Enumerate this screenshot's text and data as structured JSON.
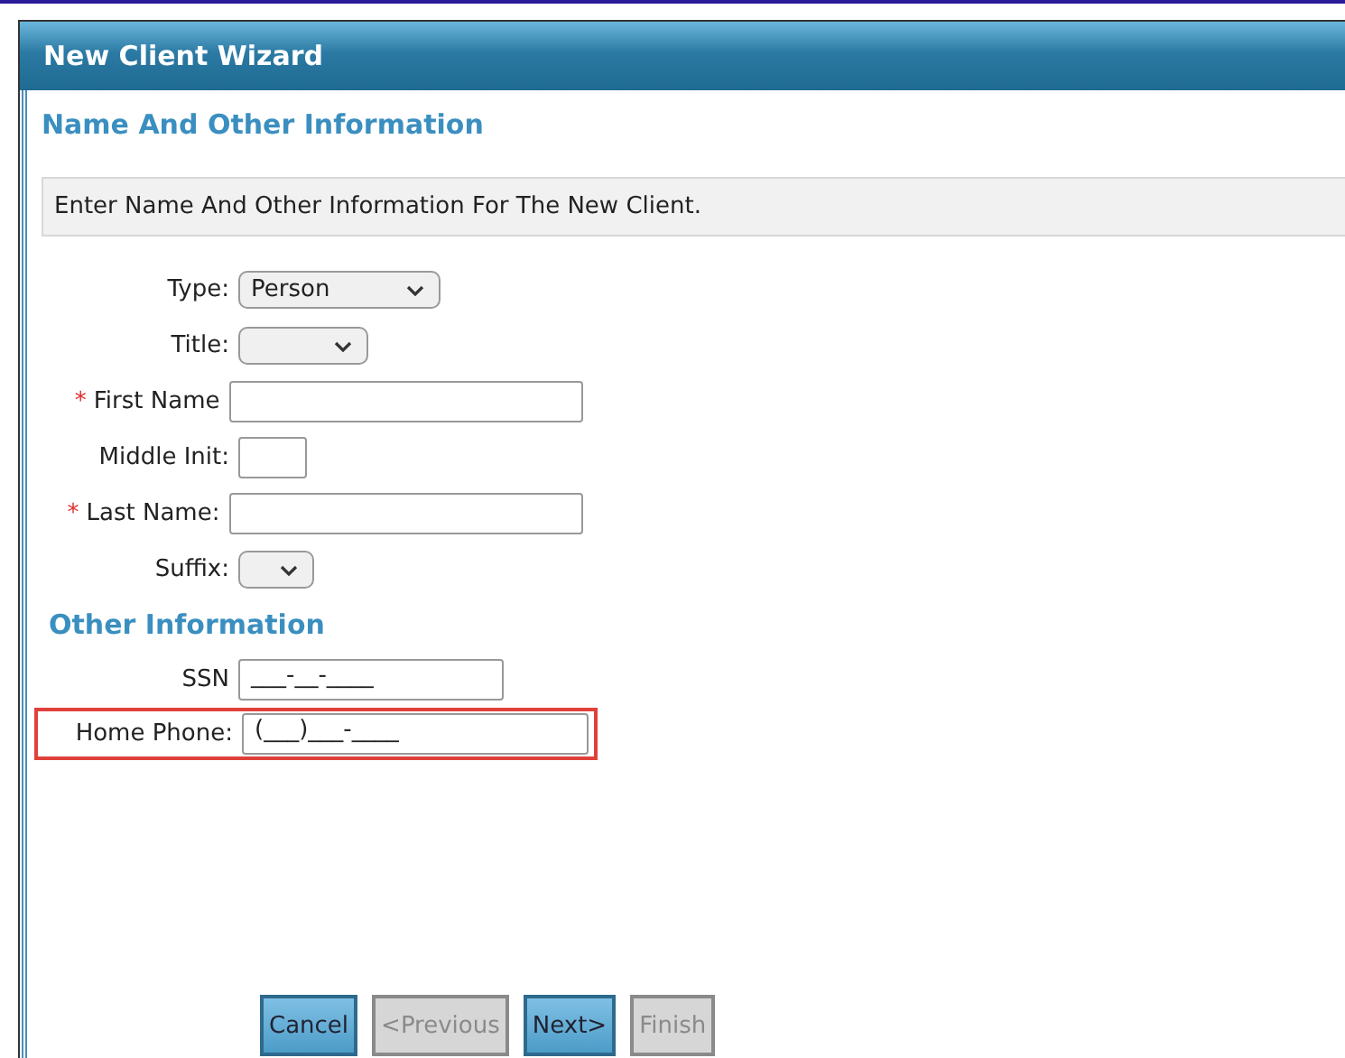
{
  "window": {
    "title": "New Client Wizard"
  },
  "step_title": "Name And Other Information",
  "instructions": "Enter Name And Other Information For The New Client.",
  "fields": [
    {
      "label": "Type:",
      "kind": "select",
      "required": false,
      "value": "Person",
      "highlighted": false
    },
    {
      "label": "Title:",
      "kind": "select",
      "required": false,
      "highlighted": false
    },
    {
      "label": "First Name",
      "kind": "text",
      "required": true,
      "highlighted": false
    },
    {
      "label": "Middle Init:",
      "kind": "text",
      "required": false,
      "highlighted": false
    },
    {
      "label": "Last Name:",
      "kind": "text",
      "required": true,
      "highlighted": false
    },
    {
      "label": "Suffix:",
      "kind": "select",
      "required": false,
      "highlighted": false
    }
  ],
  "other_section": {
    "title": "Other Information",
    "fields": [
      {
        "label": "SSN",
        "kind": "text",
        "required": false,
        "value": "___-__-____",
        "highlighted": false
      },
      {
        "label": "Home Phone:",
        "kind": "text",
        "required": false,
        "value": "(___)___-____",
        "highlighted": true
      }
    ]
  },
  "required_mark": "*",
  "buttons": [
    {
      "label": "Cancel",
      "disabled": false
    },
    {
      "label": "<Previous",
      "disabled": true
    },
    {
      "label": "Next>",
      "disabled": false
    },
    {
      "label": "Finish",
      "disabled": true
    }
  ]
}
